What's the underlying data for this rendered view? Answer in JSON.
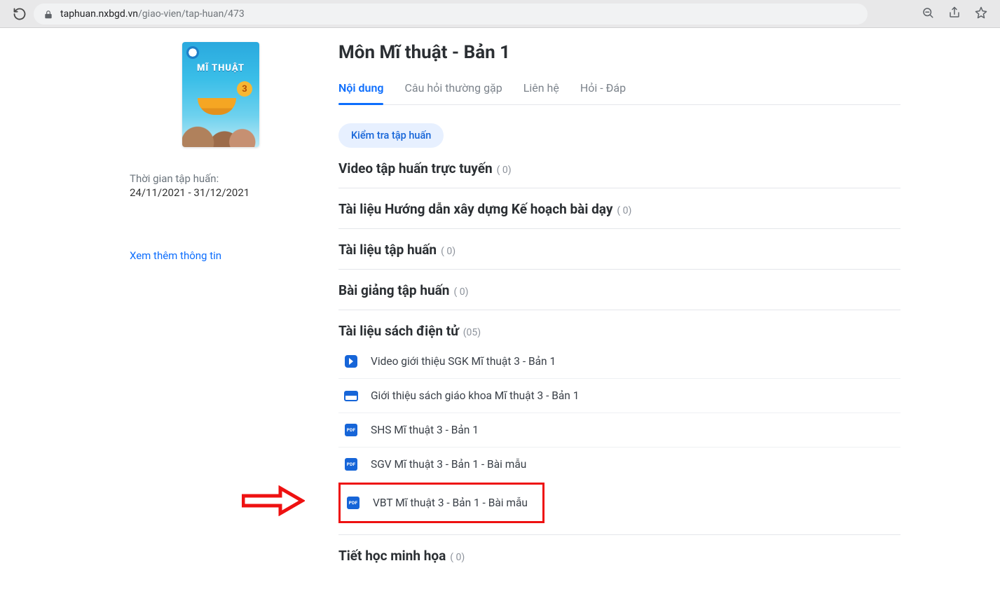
{
  "browser": {
    "url_host": "taphuan.nxbgd.vn",
    "url_path": "/giao-vien/tap-huan/473"
  },
  "sidebar": {
    "cover_title": "MĨ THUẬT",
    "cover_badge": "3",
    "period_label": "Thời gian tập huấn:",
    "period_dates": "24/11/2021 - 31/12/2021",
    "more_link": "Xem thêm thông tin"
  },
  "title": "Môn Mĩ thuật - Bản 1",
  "tabs": [
    {
      "label": "Nội dung",
      "active": true
    },
    {
      "label": "Câu hỏi thường gặp",
      "active": false
    },
    {
      "label": "Liên hệ",
      "active": false
    },
    {
      "label": "Hỏi - Đáp",
      "active": false
    }
  ],
  "check_button": "Kiểm tra tập huấn",
  "sections": [
    {
      "title": "Video tập huấn trực tuyến",
      "count": "( 0)"
    },
    {
      "title": "Tài liệu Hướng dẫn xây dựng Kế hoạch bài dạy",
      "count": "( 0)"
    },
    {
      "title": "Tài liệu tập huấn",
      "count": "( 0)"
    },
    {
      "title": "Bài giảng tập huấn",
      "count": "( 0)"
    },
    {
      "title": "Tài liệu sách điện tử",
      "count": "(05)"
    },
    {
      "title": "Tiết học minh họa",
      "count": "( 0)"
    }
  ],
  "docs": [
    {
      "icon": "play",
      "label": "Video giới thiệu SGK Mĩ thuật 3 - Bản 1"
    },
    {
      "icon": "slide",
      "label": "Giới thiệu sách giáo khoa Mĩ thuật 3 - Bản 1"
    },
    {
      "icon": "pdf",
      "label": "SHS Mĩ thuật 3 - Bản 1"
    },
    {
      "icon": "pdf",
      "label": "SGV Mĩ thuật 3 - Bản 1 - Bài mẫu"
    },
    {
      "icon": "pdf",
      "label": "VBT Mĩ thuật 3 - Bản 1 - Bài mẫu"
    }
  ],
  "pdf_badge": "PDF"
}
